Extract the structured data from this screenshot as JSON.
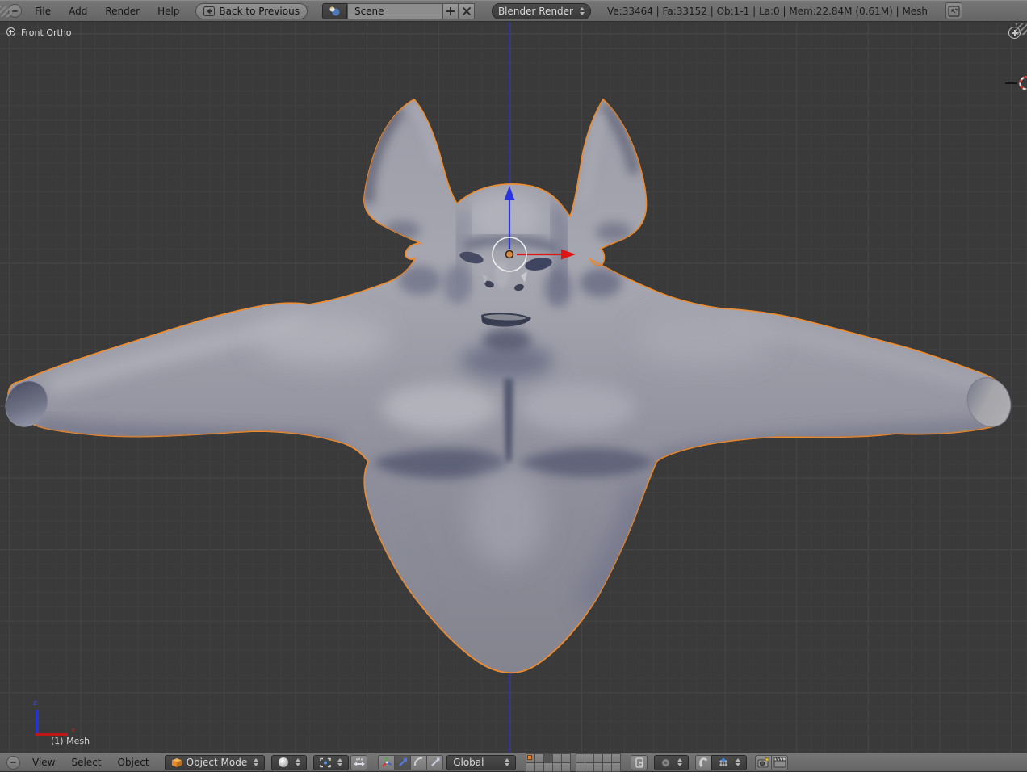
{
  "info_bar": {
    "menus": [
      {
        "label": "File"
      },
      {
        "label": "Add"
      },
      {
        "label": "Render"
      },
      {
        "label": "Help"
      }
    ],
    "back_button_label": "Back to Previous",
    "scene_field": {
      "value": "Scene"
    },
    "engine_select": {
      "value": "Blender Render"
    },
    "stats": "Ve:33464 | Fa:33152 | Ob:1-1 | La:0 | Mem:22.84M (0.61M) | Mesh"
  },
  "viewport": {
    "view_label": "Front Ortho",
    "object_info": "(1) Mesh",
    "gizmo": {
      "z_label": "z",
      "x_label": "x"
    }
  },
  "tool_bar": {
    "menus": [
      {
        "label": "View"
      },
      {
        "label": "Select"
      },
      {
        "label": "Object"
      }
    ],
    "mode_select": {
      "value": "Object Mode"
    },
    "orientation_select": {
      "value": "Global"
    },
    "layers": {
      "object_layer": 1,
      "active_layer": 3
    }
  },
  "icons": {
    "editor_type": "editor-type-icon",
    "back": "back-arrow-icon",
    "scene": "scene-datablock-icon",
    "add": "plus-icon",
    "unlink": "close-icon",
    "screen_layout": "screen-layout-icon",
    "object_mode": "cube-icon",
    "viewport_shading": "shading-sphere-icon",
    "pivot_point": "pivot-point-icon",
    "manipulate_centers": "center-points-icon",
    "manipulator": "axis-tripod-icon",
    "translate": "translate-arrow-icon",
    "rotate": "rotate-arc-icon",
    "scale": "scale-icon",
    "lock": "lock-icon",
    "proportional": "proportional-circle-icon",
    "snap": "magnet-icon",
    "snap_element": "snap-element-icon",
    "render_still": "camera-icon",
    "render_anim": "clapperboard-icon"
  },
  "colors": {
    "selection_outline": "#ee8b2d",
    "axis_blue": "#31319c",
    "manipulator_blue": "#2a35e0",
    "manipulator_red": "#df1414",
    "viewport_bg": "#3a3a3a",
    "header_bg": "#6e6e6e",
    "body_gray": "#9696a2"
  }
}
